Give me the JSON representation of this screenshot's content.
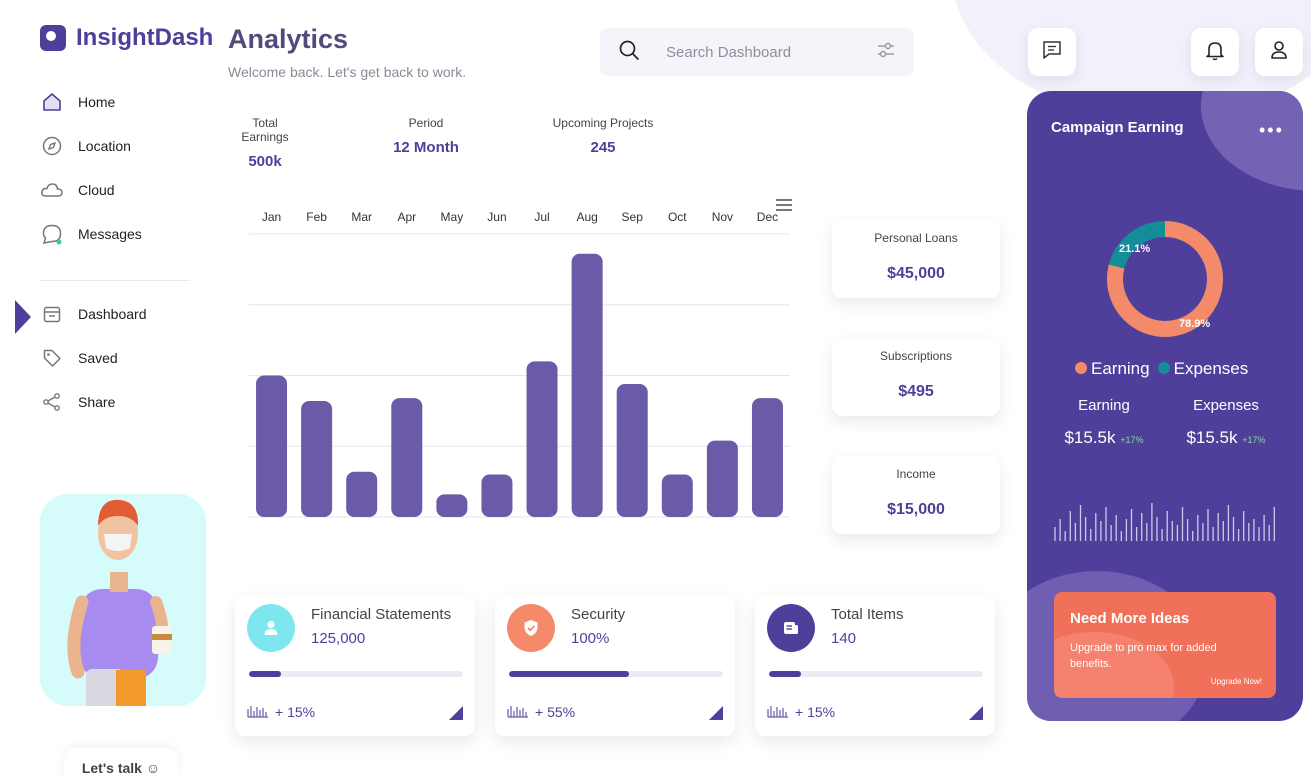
{
  "brand": {
    "name": "InsightDash"
  },
  "sidebar": {
    "items": [
      {
        "label": "Home",
        "icon": "home-icon"
      },
      {
        "label": "Location",
        "icon": "compass-icon"
      },
      {
        "label": "Cloud",
        "icon": "cloud-icon"
      },
      {
        "label": "Messages",
        "icon": "chat-icon"
      }
    ],
    "items2": [
      {
        "label": "Dashboard",
        "icon": "calendar-icon",
        "active": true
      },
      {
        "label": "Saved",
        "icon": "tag-icon"
      },
      {
        "label": "Share",
        "icon": "share-icon"
      }
    ],
    "lets_talk": "Let's talk ☺"
  },
  "header": {
    "title": "Analytics",
    "subtitle": "Welcome back. Let's get back to work.",
    "search_placeholder": "Search Dashboard"
  },
  "stats": [
    {
      "label": "Total Earnings",
      "value": "500k"
    },
    {
      "label": "Period",
      "value": "12 Month"
    },
    {
      "label": "Upcoming Projects",
      "value": "245"
    }
  ],
  "chart_data": {
    "type": "bar",
    "categories": [
      "Jan",
      "Feb",
      "Mar",
      "Apr",
      "May",
      "Jun",
      "Jul",
      "Aug",
      "Sep",
      "Oct",
      "Nov",
      "Dec"
    ],
    "values": [
      50,
      41,
      16,
      42,
      8,
      15,
      55,
      93,
      47,
      15,
      27,
      42
    ],
    "ylim": [
      0,
      100
    ],
    "grid": true,
    "color": "#6b5aa8"
  },
  "mini_cards": [
    {
      "label": "Personal Loans",
      "value": "$45,000"
    },
    {
      "label": "Subscriptions",
      "value": "$495"
    },
    {
      "label": "Income",
      "value": "$15,000"
    }
  ],
  "bottom_cards": [
    {
      "title": "Financial Statements",
      "value": "125,000",
      "change": "+ 15%",
      "progress": 0.15,
      "icon": "user-icon",
      "icon_color": "#7ee6ee"
    },
    {
      "title": "Security",
      "value": "100%",
      "change": "+ 55%",
      "progress": 0.56,
      "icon": "shield-icon",
      "icon_color": "#f58a6b"
    },
    {
      "title": "Total Items",
      "value": "140",
      "change": "+ 15%",
      "progress": 0.15,
      "icon": "document-icon",
      "icon_color": "#4f3f9a"
    }
  ],
  "panel": {
    "title": "Campaign Earning",
    "donut": {
      "earning_pct": 78.9,
      "expenses_pct": 21.1,
      "earning_label": "78.9%",
      "expenses_label": "21.1%",
      "earning_color": "#f58a6b",
      "expenses_color": "#128e98"
    },
    "legend": {
      "earning": "Earning",
      "expenses": "Expenses"
    },
    "earning": {
      "label": "Earning",
      "value": "$15.5k",
      "change": "+17%"
    },
    "expenses": {
      "label": "Expenses",
      "value": "$15.5k",
      "change": "+17%"
    },
    "ideas": {
      "title": "Need More Ideas",
      "text": "Upgrade to pro max for added benefits.",
      "link": "Upgrade Now!"
    }
  },
  "colors": {
    "accent": "#4f3f9a",
    "bar": "#6b5aa8",
    "coral": "#f0705a"
  }
}
